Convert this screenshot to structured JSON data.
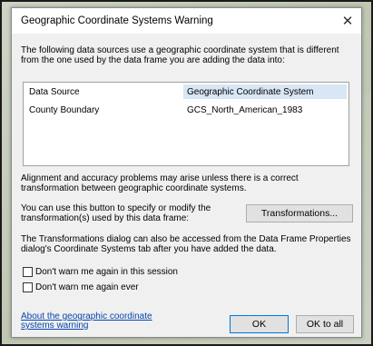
{
  "dialog": {
    "title": "Geographic Coordinate Systems Warning",
    "close_glyph": "✕",
    "intro_text": "The following data sources use a geographic coordinate system that is different from the one used by the data frame you are adding the data into:",
    "table": {
      "headers": [
        "Data Source",
        "Geographic Coordinate System"
      ],
      "rows": [
        [
          "County Boundary",
          "GCS_North_American_1983"
        ]
      ]
    },
    "alignment_text": "Alignment and accuracy problems may arise unless there is a correct transformation between geographic coordinate systems.",
    "specify_text": "You can use this button to specify or modify the transformation(s) used by this data frame:",
    "transformations_button": "Transformations...",
    "transformations_info": "The Transformations dialog can also be accessed from the Data Frame Properties dialog's Coordinate Systems tab after you have added the data.",
    "checkboxes": [
      {
        "label": "Don't warn me again in this session",
        "checked": false
      },
      {
        "label": "Don't warn me again ever",
        "checked": false
      }
    ],
    "help_link": "About the geographic coordinate systems warning",
    "ok_button": "OK",
    "ok_to_all_button": "OK to all"
  },
  "colors": {
    "link": "#0645ad",
    "header_highlight": "#d8e6f5",
    "ok_border": "#0078d7"
  }
}
